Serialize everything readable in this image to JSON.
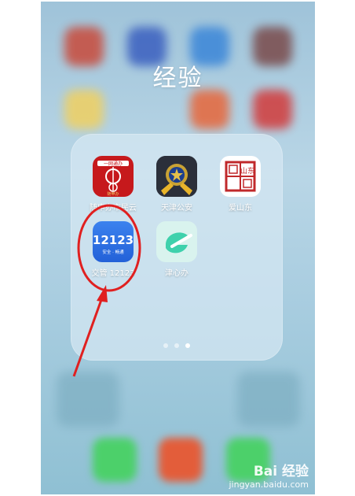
{
  "folder": {
    "title": "经验",
    "apps": [
      {
        "label": "随申办市民云",
        "icon": "suishenban-icon",
        "icon_text": "一网通办",
        "icon_subtext": "随申办"
      },
      {
        "label": "天津公安",
        "icon": "tianjin-police-icon"
      },
      {
        "label": "爱山东",
        "icon": "aishandong-icon",
        "icon_text": "山东"
      },
      {
        "label": "交管 12123",
        "icon": "jiaoguan-12123-icon",
        "icon_text": "12123",
        "icon_subtext": "安全 · 畅通"
      },
      {
        "label": "津心办",
        "icon": "jinxinban-icon"
      }
    ],
    "page_dots": 3,
    "active_page_index": 2
  },
  "watermark": {
    "main": "Bai 经验",
    "sub": "jingyan.baidu.com"
  },
  "colors": {
    "annotation": "#e02020",
    "jiaoguan_blue": "#2a6fe0",
    "suishenban_red": "#c6191c",
    "jinxinban_green": "#3fd1ac"
  }
}
